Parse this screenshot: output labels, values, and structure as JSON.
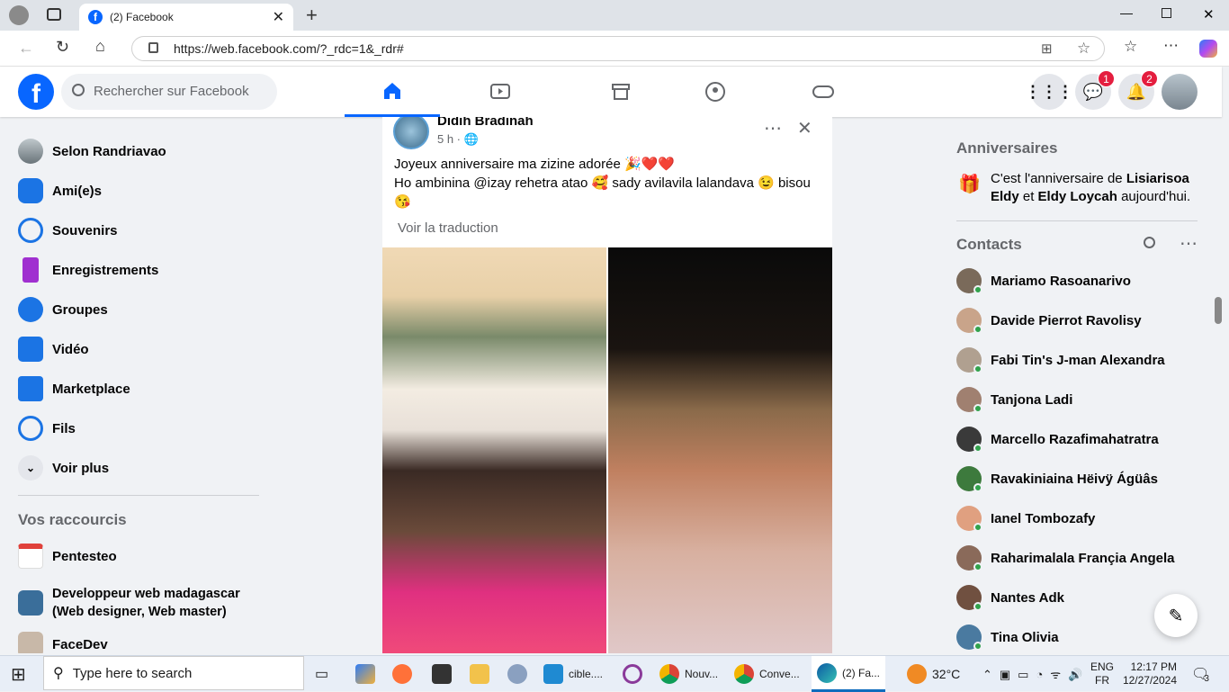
{
  "browser": {
    "tab_title": "(2) Facebook",
    "url": "https://web.facebook.com/?_rdc=1&_rdr#"
  },
  "header": {
    "search_placeholder": "Rechercher sur Facebook",
    "messenger_badge": "1",
    "notif_badge": "2"
  },
  "left": {
    "items": [
      {
        "label": "Selon Randriavao"
      },
      {
        "label": "Ami(e)s"
      },
      {
        "label": "Souvenirs"
      },
      {
        "label": "Enregistrements"
      },
      {
        "label": "Groupes"
      },
      {
        "label": "Vidéo"
      },
      {
        "label": "Marketplace"
      },
      {
        "label": "Fils"
      },
      {
        "label": "Voir plus"
      }
    ],
    "shortcuts_title": "Vos raccourcis",
    "shortcuts": [
      {
        "label": "Pentesteo"
      },
      {
        "label": "Developpeur web madagascar (Web designer, Web master)"
      },
      {
        "label": "FaceDev"
      }
    ]
  },
  "post": {
    "author": "Didih Bradinah",
    "time": "5 h ·",
    "line1": "Joyeux anniversaire ma zizine adorée 🎉❤️❤️",
    "line2": "Ho ambinina @izay rehetra atao 🥰 sady avilavila lalandava 😉 bisou 😘",
    "translate": "Voir la traduction"
  },
  "right": {
    "birthday_title": "Anniversaires",
    "birthday_pre": "C'est l'anniversaire de ",
    "birthday_name1": "Lisiarisoa Eldy",
    "birthday_mid": " et ",
    "birthday_name2": "Eldy Loycah",
    "birthday_post": " aujourd'hui.",
    "contacts_title": "Contacts",
    "contacts": [
      {
        "name": "Mariamo Rasoanarivo",
        "color": "#7a6a5a"
      },
      {
        "name": "Davide Pierrot Ravolisy",
        "color": "#c9a48a"
      },
      {
        "name": "Fabi Tin's J-man Alexandra",
        "color": "#b0a090"
      },
      {
        "name": "Tanjona Ladi",
        "color": "#a08070"
      },
      {
        "name": "Marcello Razafimahatratra",
        "color": "#3a3a3a"
      },
      {
        "name": "Ravakiniaina Hëivÿ Ágüâs",
        "color": "#3d7a3d"
      },
      {
        "name": "Ianel Tombozafy",
        "color": "#e0a080"
      },
      {
        "name": "Raharimalala Françia Angela",
        "color": "#8a6a5a"
      },
      {
        "name": "Nantes Adk",
        "color": "#705040"
      },
      {
        "name": "Tina Olivia",
        "color": "#4a7aa0"
      }
    ]
  },
  "taskbar": {
    "search": "Type here to search",
    "apps": [
      {
        "label": "cible...."
      },
      {
        "label": "Nouv..."
      },
      {
        "label": "Conve..."
      },
      {
        "label": "(2) Fa..."
      }
    ],
    "weather": "32°C",
    "lang1": "ENG",
    "lang2": "FR",
    "time": "12:17 PM",
    "date": "12/27/2024",
    "notif_count": "3"
  }
}
